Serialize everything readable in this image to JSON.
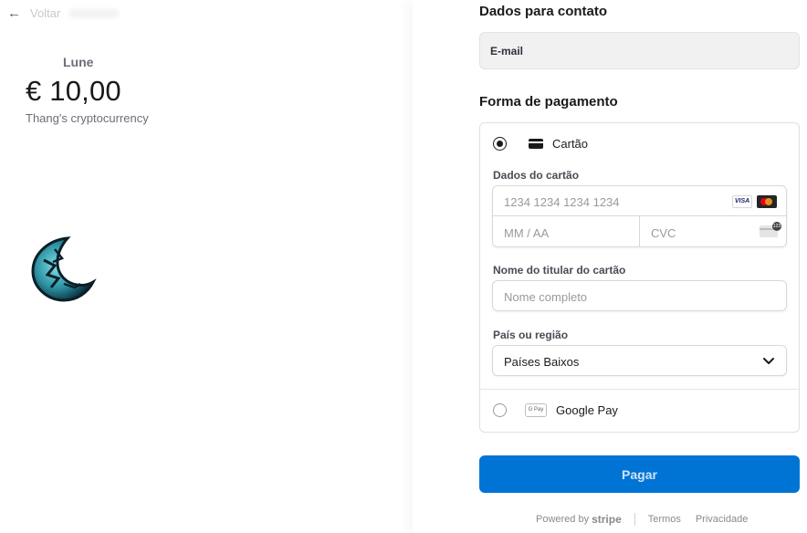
{
  "header": {
    "back_label": "Voltar"
  },
  "product": {
    "name": "Lune",
    "price": "€ 10,00",
    "description": "Thang's cryptocurrency",
    "image_icon": "crescent-moon-logo"
  },
  "contact": {
    "title": "Dados para contato",
    "email_label": "E-mail"
  },
  "payment": {
    "title": "Forma de pagamento",
    "methods": [
      {
        "label": "Cartão",
        "selected": true,
        "icon": "credit-card-icon"
      },
      {
        "label": "Google Pay",
        "selected": false,
        "icon": "google-pay-icon"
      }
    ],
    "card_details_label": "Dados do cartão",
    "card_number_placeholder": "1234 1234 1234 1234",
    "expiry_placeholder": "MM / AA",
    "cvc_placeholder": "CVC",
    "card_brands": [
      "VISA",
      "Mastercard"
    ],
    "cardholder_label": "Nome do titular do cartão",
    "cardholder_placeholder": "Nome completo",
    "country_label": "País ou região",
    "country_value": "Países Baixos"
  },
  "actions": {
    "pay_label": "Pagar"
  },
  "footer": {
    "powered_by": "Powered by",
    "brand": "stripe",
    "terms": "Termos",
    "privacy": "Privacidade"
  },
  "colors": {
    "accent": "#0074d4",
    "text": "#1a1a1a",
    "muted": "#6d6e78"
  }
}
